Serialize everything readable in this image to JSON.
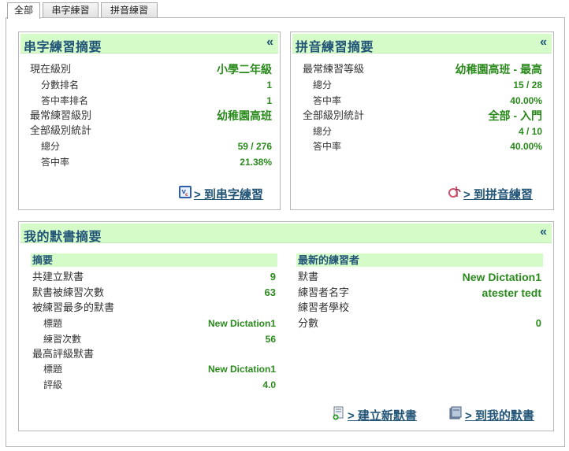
{
  "tabs": [
    {
      "label": "全部"
    },
    {
      "label": "串字練習"
    },
    {
      "label": "拼音練習"
    }
  ],
  "spelling_summary": {
    "title": "串字練習摘要",
    "collapse": "«",
    "current_level_label": "現在級別",
    "current_level_value": "小學二年級",
    "score_rank_label": "分數排名",
    "score_rank_value": "1",
    "accuracy_rank_label": "答中率排名",
    "accuracy_rank_value": "1",
    "frequent_level_label": "最常練習級別",
    "frequent_level_value": "幼稚園高班",
    "all_levels_label": "全部級別統計",
    "total_label": "總分",
    "total_value": "59 / 276",
    "accuracy_label": "答中率",
    "accuracy_value": "21.38%",
    "link_label": "> 到串字練習"
  },
  "pinyin_summary": {
    "title": "拼音練習摘要",
    "collapse": "«",
    "frequent_level_label": "最常練習等級",
    "frequent_level_value": "幼稚園高班 - 最高",
    "total_label": "總分",
    "total_value": "15 / 28",
    "accuracy_label": "答中率",
    "accuracy_value": "40.00%",
    "all_levels_label": "全部級別統計",
    "all_levels_value": "全部 - 入門",
    "total2_label": "總分",
    "total2_value": "4 / 10",
    "accuracy2_label": "答中率",
    "accuracy2_value": "40.00%",
    "link_label": "> 到拼音練習"
  },
  "dictation_summary": {
    "title": "我的默書摘要",
    "collapse": "«",
    "summary_head": "摘要",
    "created_label": "共建立默書",
    "created_value": "9",
    "practiced_label": "默書被練習次數",
    "practiced_value": "63",
    "most_practiced_label": "被練習最多的默書",
    "mp_title_label": "標題",
    "mp_title_value": "New Dictation1",
    "mp_count_label": "練習次數",
    "mp_count_value": "56",
    "top_rated_label": "最高評級默書",
    "tr_title_label": "標題",
    "tr_title_value": "New Dictation1",
    "tr_rating_label": "評級",
    "tr_rating_value": "4.0",
    "latest_head": "最新的練習者",
    "dictation_label": "默書",
    "dictation_value": "New Dictation1",
    "practitioner_label": "練習者名字",
    "practitioner_value": "atester tedt",
    "school_label": "練習者學校",
    "score_label": "分數",
    "score_value": "0",
    "new_link": "> 建立新默書",
    "my_link": "> 到我的默書"
  }
}
